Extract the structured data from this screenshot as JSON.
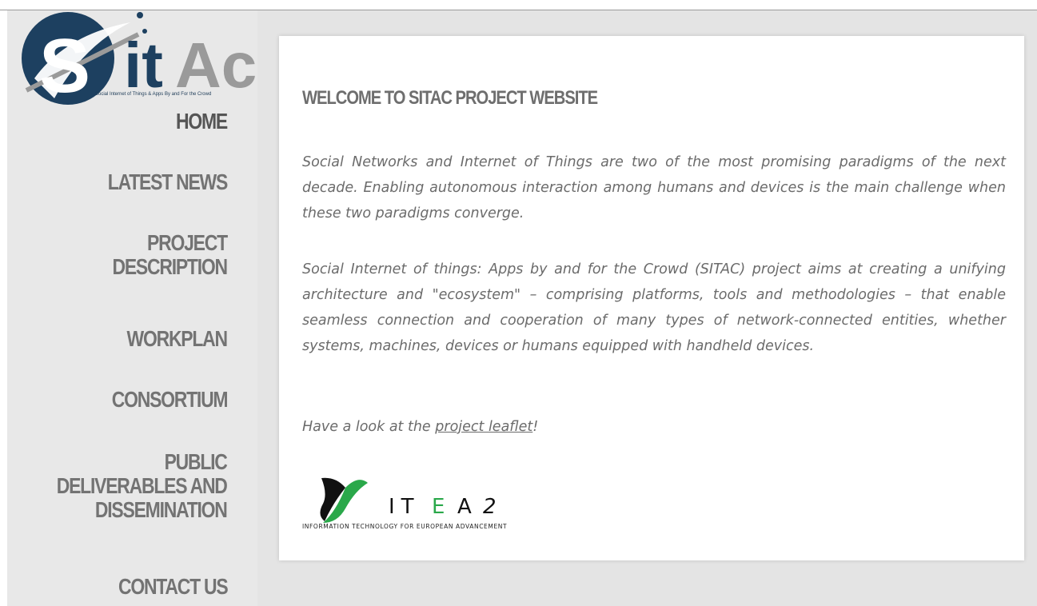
{
  "logo": {
    "wordmark_left": "S",
    "wordmark_it": "it",
    "wordmark_ac": "Ac",
    "tagline": "Social Internet of Things & Apps By and For the Crowd",
    "colors": {
      "navy": "#1d4060",
      "grey": "#9a9a9a"
    }
  },
  "nav": {
    "home": "HOME",
    "latest_news": "LATEST NEWS",
    "project_description_1": "PROJECT",
    "project_description_2": "DESCRIPTION",
    "workplan": "WORKPLAN",
    "consortium": "CONSORTIUM",
    "public_1": "PUBLIC",
    "public_2": "DELIVERABLES AND",
    "public_3": "DISSEMINATION",
    "contact_us": "CONTACT US"
  },
  "main": {
    "title": "WELCOME TO SITAC PROJECT WEBSITE",
    "paragraph_1": "Social Networks and Internet of Things are two of the most promising paradigms of the next decade. Enabling autonomous interaction among humans and devices is the main challenge when these two paradigms converge.",
    "paragraph_2": "Social Internet of things: Apps by and for the Crowd (SITAC) project aims at creating a unifying architecture and \"ecosystem\" – comprising platforms, tools and methodologies – that enable seamless connection and cooperation of many types of network-connected entities, whether systems, machines, devices or humans equipped with handheld devices.",
    "leaflet_prefix": "Have a look at the ",
    "leaflet_link": "project leaflet",
    "leaflet_suffix": "!"
  },
  "itea_logo": {
    "letters_it": "IT",
    "letter_e": "E",
    "letters_a": "A",
    "letter_2": "2",
    "caption": "INFORMATION TECHNOLOGY FOR EUROPEAN ADVANCEMENT",
    "colors": {
      "green": "#2aa84a",
      "black": "#111111"
    }
  }
}
